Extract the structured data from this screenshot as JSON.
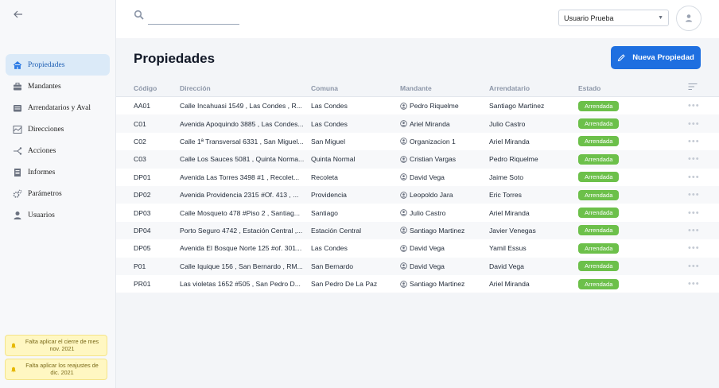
{
  "topbar": {
    "search_placeholder": "",
    "user_selected": "Usuario Prueba"
  },
  "sidebar": {
    "items": [
      {
        "label": "Propiedades",
        "icon": "home-icon",
        "active": true
      },
      {
        "label": "Mandantes",
        "icon": "briefcase-icon",
        "active": false
      },
      {
        "label": "Arrendatarios y Aval",
        "icon": "id-card-icon",
        "active": false
      },
      {
        "label": "Direcciones",
        "icon": "map-icon",
        "active": false
      },
      {
        "label": "Acciones",
        "icon": "share-icon",
        "active": false
      },
      {
        "label": "Informes",
        "icon": "document-icon",
        "active": false
      },
      {
        "label": "Parámetros",
        "icon": "gears-icon",
        "active": false
      },
      {
        "label": "Usuarios",
        "icon": "user-icon",
        "active": false
      }
    ],
    "alerts": [
      {
        "text": "Falta aplicar el cierre de mes nov. 2021"
      },
      {
        "text": "Falta aplicar los reajustes de dic. 2021"
      }
    ]
  },
  "main": {
    "title": "Propiedades",
    "new_button_label": "Nueva Propiedad",
    "columns": [
      "Código",
      "Dirección",
      "Comuna",
      "Mandante",
      "Arrendatario",
      "Estado"
    ],
    "rows": [
      {
        "code": "AA01",
        "dir": "Calle Incahuasi 1549 , Las Condes , R...",
        "comuna": "Las Condes",
        "mandante": "Pedro Riquelme",
        "arrendatario": "Santiago Martinez",
        "estado": "Arrendada"
      },
      {
        "code": "C01",
        "dir": "Avenida Apoquindo 3885 , Las Condes...",
        "comuna": "Las Condes",
        "mandante": "Ariel Miranda",
        "arrendatario": "Julio Castro",
        "estado": "Arrendada"
      },
      {
        "code": "C02",
        "dir": "Calle 1ª Transversal 6331 , San Miguel...",
        "comuna": "San Miguel",
        "mandante": "Organizacion 1",
        "arrendatario": "Ariel Miranda",
        "estado": "Arrendada"
      },
      {
        "code": "C03",
        "dir": "Calle Los Sauces 5081 , Quinta Norma...",
        "comuna": "Quinta Normal",
        "mandante": "Cristian Vargas",
        "arrendatario": "Pedro Riquelme",
        "estado": "Arrendada"
      },
      {
        "code": "DP01",
        "dir": "Avenida Las Torres 3498 #1 , Recolet...",
        "comuna": "Recoleta",
        "mandante": "David Vega",
        "arrendatario": "Jaime Soto",
        "estado": "Arrendada"
      },
      {
        "code": "DP02",
        "dir": "Avenida Providencia 2315 #Of. 413 , ...",
        "comuna": "Providencia",
        "mandante": "Leopoldo Jara",
        "arrendatario": "Eric Torres",
        "estado": "Arrendada"
      },
      {
        "code": "DP03",
        "dir": "Calle Mosqueto 478 #Piso 2 , Santiag...",
        "comuna": "Santiago",
        "mandante": "Julio Castro",
        "arrendatario": "Ariel Miranda",
        "estado": "Arrendada"
      },
      {
        "code": "DP04",
        "dir": "Porto Seguro 4742 , Estación Central ,...",
        "comuna": "Estación Central",
        "mandante": "Santiago Martinez",
        "arrendatario": "Javier Venegas",
        "estado": "Arrendada"
      },
      {
        "code": "DP05",
        "dir": "Avenida El Bosque Norte 125 #of. 301...",
        "comuna": "Las Condes",
        "mandante": "David Vega",
        "arrendatario": "Yamil Essus",
        "estado": "Arrendada"
      },
      {
        "code": "P01",
        "dir": "Calle Iquique 156 , San Bernardo , RM...",
        "comuna": "San Bernardo",
        "mandante": "David Vega",
        "arrendatario": "David Vega",
        "estado": "Arrendada"
      },
      {
        "code": "PR01",
        "dir": "Las violetas 1652 #505 , San Pedro D...",
        "comuna": "San Pedro De La Paz",
        "mandante": "Santiago Martinez",
        "arrendatario": "Ariel Miranda",
        "estado": "Arrendada"
      }
    ]
  },
  "colors": {
    "accent": "#1e6fe0",
    "active_nav_bg": "#dbeaf8",
    "status_green": "#6cc04a",
    "alert_bg": "#fff7c2"
  }
}
